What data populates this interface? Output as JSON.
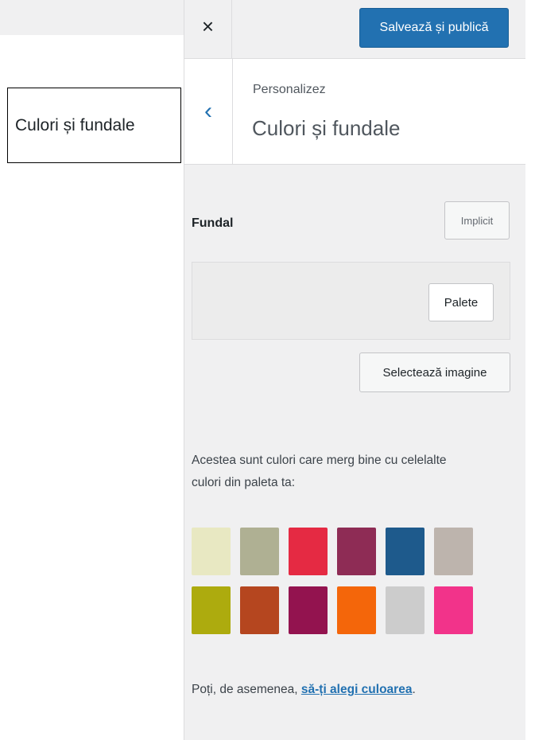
{
  "left_label": "Culori și fundale",
  "header": {
    "close_icon": "×",
    "save_label": "Salvează și publică"
  },
  "section": {
    "back_icon": "‹",
    "breadcrumb": "Personalizez",
    "title": "Culori și fundale"
  },
  "control": {
    "title": "Fundal",
    "default_label": "Implicit",
    "palette_label": "Palete",
    "select_image_label": "Selectează imagine",
    "description": "Acestea sunt culori care merg bine cu celelalte culori din paleta ta:"
  },
  "swatches": [
    "#e8e8c2",
    "#afb093",
    "#e52a43",
    "#8e2c55",
    "#1e5a8c",
    "#bdb4ad",
    "#adab0e",
    "#b5461f",
    "#93134f",
    "#f4660a",
    "#cccccc",
    "#f2338a"
  ],
  "footer": {
    "prefix": "Poți, de asemenea, ",
    "link": "să-ți alegi culoarea",
    "suffix": "."
  }
}
